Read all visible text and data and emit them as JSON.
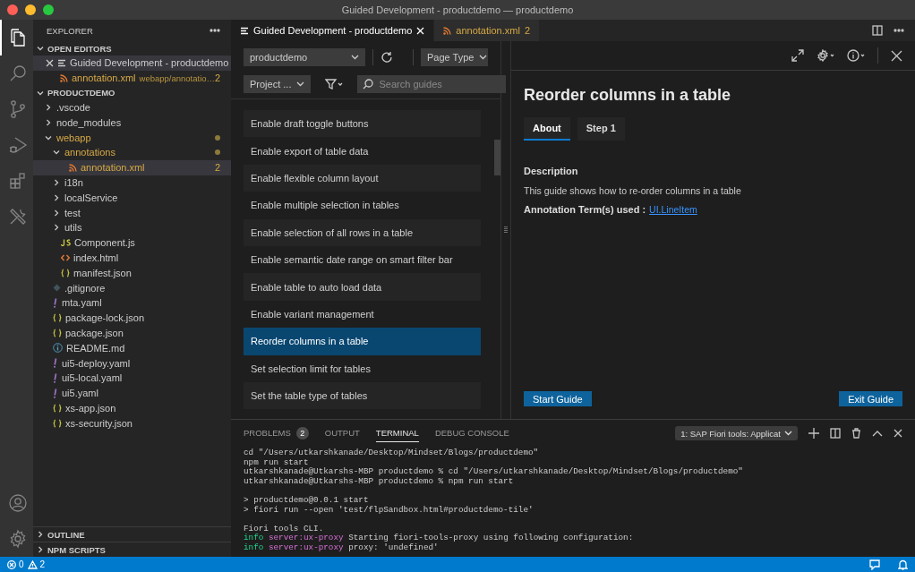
{
  "window": {
    "title": "Guided Development - productdemo — productdemo"
  },
  "activity_bar": [
    {
      "kind": "explorer",
      "selected": true
    },
    {
      "kind": "search",
      "selected": false
    },
    {
      "kind": "source-control",
      "selected": false
    },
    {
      "kind": "run",
      "selected": false
    },
    {
      "kind": "extensions",
      "selected": false
    },
    {
      "kind": "tools",
      "selected": false
    }
  ],
  "sidebar": {
    "title": "EXPLORER",
    "open_editors": {
      "title": "OPEN EDITORS",
      "expanded": true,
      "items": [
        {
          "kind": "guide",
          "name": "Guided Development - productdemo",
          "selected": true,
          "modified": false
        },
        {
          "kind": "xml",
          "name": "annotation.xml",
          "detail": "webapp/annotatio…",
          "badge": "2",
          "selected": false,
          "modified": true
        }
      ]
    },
    "project": {
      "title": "PRODUCTDEMO",
      "expanded": true,
      "items": [
        {
          "kind": "folder",
          "name": ".vscode",
          "expanded": false,
          "modified": false,
          "selected": false
        },
        {
          "kind": "folder",
          "name": "node_modules",
          "expanded": false,
          "modified": false,
          "selected": false
        },
        {
          "kind": "folder",
          "name": "webapp",
          "expanded": true,
          "modified": true,
          "selected": false,
          "children": [
            {
              "kind": "folder",
              "name": "annotations",
              "expanded": true,
              "modified": true,
              "selected": false,
              "children": [
                {
                  "kind": "xml",
                  "name": "annotation.xml",
                  "badge": "2",
                  "modified": true,
                  "selected": true
                }
              ]
            },
            {
              "kind": "folder",
              "name": "i18n",
              "expanded": false,
              "modified": false,
              "selected": false
            },
            {
              "kind": "folder",
              "name": "localService",
              "expanded": false,
              "modified": false,
              "selected": false
            },
            {
              "kind": "folder",
              "name": "test",
              "expanded": false,
              "modified": false,
              "selected": false
            },
            {
              "kind": "folder",
              "name": "utils",
              "expanded": false,
              "modified": false,
              "selected": false
            },
            {
              "kind": "js",
              "name": "Component.js",
              "modified": false,
              "selected": false
            },
            {
              "kind": "html",
              "name": "index.html",
              "modified": false,
              "selected": false
            },
            {
              "kind": "json",
              "name": "manifest.json",
              "modified": false,
              "selected": false
            }
          ]
        },
        {
          "kind": "git",
          "name": ".gitignore",
          "modified": false,
          "selected": false
        },
        {
          "kind": "yaml",
          "name": "mta.yaml",
          "modified": false,
          "selected": false
        },
        {
          "kind": "json",
          "name": "package-lock.json",
          "modified": false,
          "selected": false
        },
        {
          "kind": "json",
          "name": "package.json",
          "modified": false,
          "selected": false
        },
        {
          "kind": "md",
          "name": "README.md",
          "modified": false,
          "selected": false
        },
        {
          "kind": "yaml",
          "name": "ui5-deploy.yaml",
          "modified": false,
          "selected": false
        },
        {
          "kind": "yaml",
          "name": "ui5-local.yaml",
          "modified": false,
          "selected": false
        },
        {
          "kind": "yaml",
          "name": "ui5.yaml",
          "modified": false,
          "selected": false
        },
        {
          "kind": "json",
          "name": "xs-app.json",
          "modified": false,
          "selected": false
        },
        {
          "kind": "json",
          "name": "xs-security.json",
          "modified": false,
          "selected": false
        }
      ]
    },
    "sections": [
      {
        "title": "OUTLINE",
        "expanded": false
      },
      {
        "title": "NPM SCRIPTS",
        "expanded": false
      }
    ]
  },
  "editor_tabs": [
    {
      "kind": "guide",
      "label": "Guided Development - productdemo",
      "selected": true,
      "modified": false
    },
    {
      "kind": "xml",
      "label": "annotation.xml",
      "badge": "2",
      "selected": false,
      "modified": true
    }
  ],
  "guides": {
    "project_select": "productdemo",
    "page_type_select": "Page Type",
    "project_filter": "Project ...",
    "search": {
      "placeholder": "Search guides"
    },
    "items": [
      {
        "label": "Enable draft toggle buttons",
        "selected": false
      },
      {
        "label": "Enable export of table data",
        "selected": false
      },
      {
        "label": "Enable flexible column layout",
        "selected": false
      },
      {
        "label": "Enable multiple selection in tables",
        "selected": false
      },
      {
        "label": "Enable selection of all rows in a table",
        "selected": false
      },
      {
        "label": "Enable semantic date range on smart filter bar",
        "selected": false
      },
      {
        "label": "Enable table to auto load data",
        "selected": false
      },
      {
        "label": "Enable variant management",
        "selected": false
      },
      {
        "label": "Reorder columns in a table",
        "selected": true
      },
      {
        "label": "Set selection limit for tables",
        "selected": false
      },
      {
        "label": "Set the table type of tables",
        "selected": false
      }
    ]
  },
  "detail": {
    "title": "Reorder columns in a table",
    "tabs": [
      {
        "label": "About",
        "selected": true
      },
      {
        "label": "Step 1",
        "selected": false
      }
    ],
    "heading": "Description",
    "description": "This guide shows how to re-order columns in a table",
    "annotation_label": "Annotation Term(s) used :",
    "annotation_link": "UI.LineItem",
    "start_button": "Start Guide",
    "exit_button": "Exit Guide"
  },
  "panel": {
    "tabs": [
      {
        "label": "PROBLEMS",
        "badge": "2",
        "selected": false
      },
      {
        "label": "OUTPUT",
        "selected": false
      },
      {
        "label": "TERMINAL",
        "selected": true
      },
      {
        "label": "DEBUG CONSOLE",
        "selected": false
      }
    ],
    "terminal_select": "1: SAP Fiori tools: Applicat",
    "lines": [
      {
        "kind": "plain",
        "text": "cd \"/Users/utkarshkanade/Desktop/Mindset/Blogs/productdemo\""
      },
      {
        "kind": "plain",
        "text": "npm run start"
      },
      {
        "kind": "plain",
        "text": "utkarshkanade@Utkarshs-MBP productdemo % cd \"/Users/utkarshkanade/Desktop/Mindset/Blogs/productdemo\""
      },
      {
        "kind": "plain",
        "text": "utkarshkanade@Utkarshs-MBP productdemo % npm run start"
      },
      {
        "kind": "blank"
      },
      {
        "kind": "plain",
        "text": "> productdemo@0.0.1 start"
      },
      {
        "kind": "plain",
        "text": "> fiori run --open 'test/flpSandbox.html#productdemo-tile'"
      },
      {
        "kind": "blank"
      },
      {
        "kind": "plain",
        "text": "Fiori tools CLI."
      },
      {
        "kind": "log",
        "level": "info",
        "source": "server:ux-proxy",
        "text": "Starting fiori-tools-proxy using following configuration:"
      },
      {
        "kind": "log",
        "level": "info",
        "source": "server:ux-proxy",
        "text": "proxy: 'undefined'"
      }
    ]
  },
  "status_bar": {
    "errors": "0",
    "warnings": "2"
  }
}
